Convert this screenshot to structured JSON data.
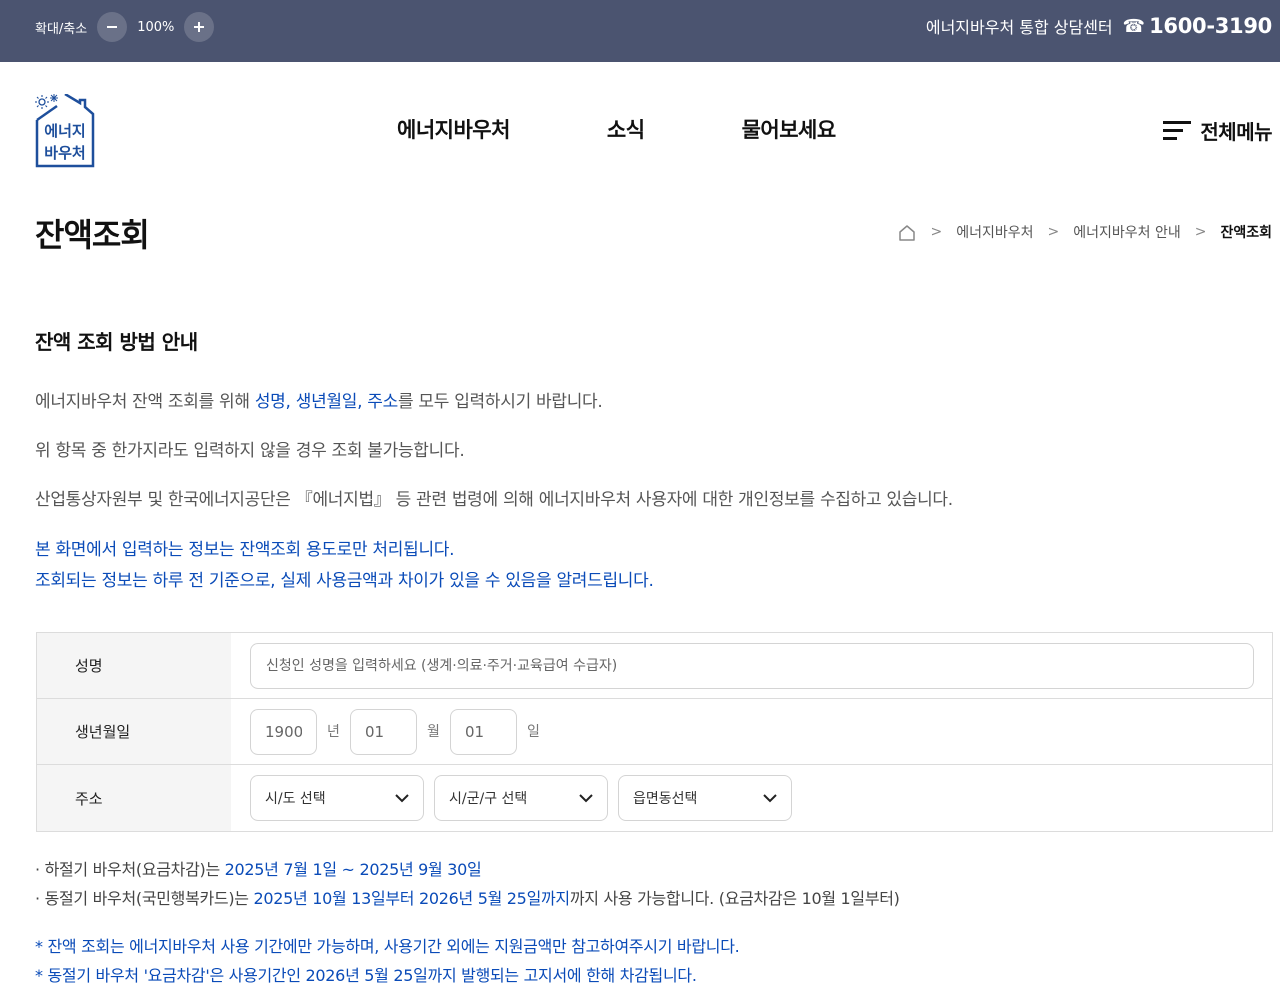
{
  "topbar": {
    "zoom_label": "확대/축소",
    "zoom_value": "100%",
    "contact_label": "에너지바우처 통합 상담센터",
    "phone_icon": "☎",
    "phone_number": "1600-3190"
  },
  "logo": {
    "line1": "에너지",
    "line2": "바우처",
    "color": "#1e4f9c"
  },
  "nav": {
    "items": [
      "에너지바우처",
      "소식",
      "물어보세요"
    ],
    "all_menu_label": "전체메뉴"
  },
  "page": {
    "title": "잔액조회",
    "breadcrumb": [
      "에너지바우처",
      "에너지바우처 안내",
      "잔액조회"
    ]
  },
  "guide": {
    "title": "잔액 조회 방법 안내",
    "line1": {
      "pre": "에너지바우처 잔액 조회를 위해 ",
      "highlight": "성명, 생년월일, 주소",
      "post": "를 모두 입력하시기 바랍니다."
    },
    "line2": "위 항목 중 한가지라도 입력하지 않을 경우 조회 불가능합니다.",
    "line3": "산업통상자원부 및 한국에너지공단은 『에너지법』 등 관련 법령에 의해 에너지바우처 사용자에 대한 개인정보를 수집하고 있습니다.",
    "blue1": "본 화면에서 입력하는 정보는 잔액조회 용도로만 처리됩니다.",
    "blue2": "조회되는 정보는 하루 전 기준으로, 실제 사용금액과 차이가 있을 수 있음을 알려드립니다."
  },
  "form": {
    "name_label": "성명",
    "name_placeholder": "신청인 성명을 입력하세요 (생계·의료·주거·교육급여 수급자)",
    "birth_label": "생년월일",
    "year_value": "1900",
    "year_unit": "년",
    "month_value": "01",
    "month_unit": "월",
    "day_value": "01",
    "day_unit": "일",
    "address_label": "주소",
    "sido_value": "시/도 선택",
    "sigungu_value": "시/군/구 선택",
    "eupmyeondong_value": "읍면동선택"
  },
  "notes": {
    "summer": {
      "pre": "· 하절기 바우처(요금차감)는 ",
      "highlight": "2025년 7월 1일 ~ 2025년 9월 30일"
    },
    "winter": {
      "pre": "· 동절기 바우처(국민행복카드)는 ",
      "highlight": "2025년 10월 13일부터 2026년 5월 25일까지",
      "post": "까지 사용 가능합니다. (요금차감은 10월 1일부터)"
    },
    "star1": "* 잔액 조회는 에너지바우처 사용 기간에만 가능하며, 사용기간 외에는 지원금액만 참고하여주시기 바랍니다.",
    "star2": "* 동절기 바우처 '요금차감'은 사용기간인 2026년 5월 25일까지 발행되는 고지서에 한해 차감됩니다."
  },
  "colors": {
    "topbar": "#4b5470",
    "accent_blue": "#0a4bb8"
  }
}
